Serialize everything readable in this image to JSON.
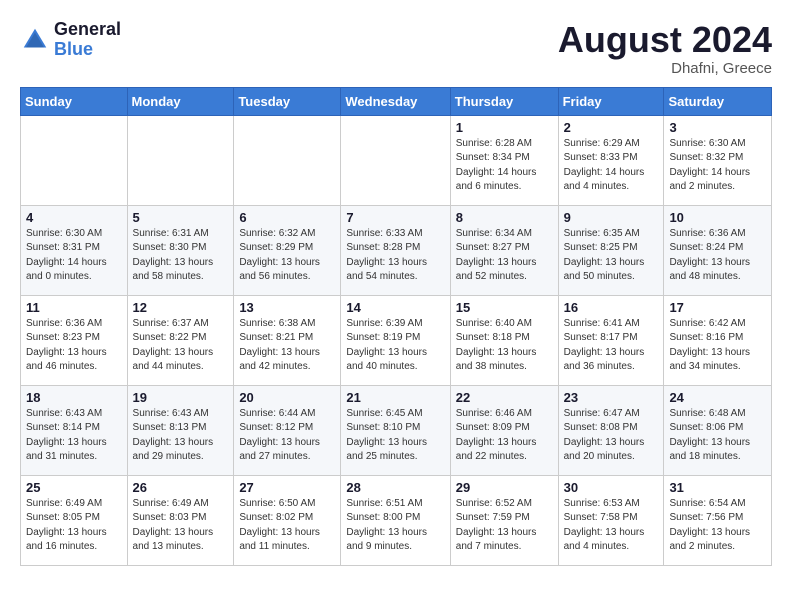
{
  "header": {
    "logo_general": "General",
    "logo_blue": "Blue",
    "month_year": "August 2024",
    "location": "Dhafni, Greece"
  },
  "weekdays": [
    "Sunday",
    "Monday",
    "Tuesday",
    "Wednesday",
    "Thursday",
    "Friday",
    "Saturday"
  ],
  "weeks": [
    [
      {
        "day": "",
        "info": ""
      },
      {
        "day": "",
        "info": ""
      },
      {
        "day": "",
        "info": ""
      },
      {
        "day": "",
        "info": ""
      },
      {
        "day": "1",
        "info": "Sunrise: 6:28 AM\nSunset: 8:34 PM\nDaylight: 14 hours\nand 6 minutes."
      },
      {
        "day": "2",
        "info": "Sunrise: 6:29 AM\nSunset: 8:33 PM\nDaylight: 14 hours\nand 4 minutes."
      },
      {
        "day": "3",
        "info": "Sunrise: 6:30 AM\nSunset: 8:32 PM\nDaylight: 14 hours\nand 2 minutes."
      }
    ],
    [
      {
        "day": "4",
        "info": "Sunrise: 6:30 AM\nSunset: 8:31 PM\nDaylight: 14 hours\nand 0 minutes."
      },
      {
        "day": "5",
        "info": "Sunrise: 6:31 AM\nSunset: 8:30 PM\nDaylight: 13 hours\nand 58 minutes."
      },
      {
        "day": "6",
        "info": "Sunrise: 6:32 AM\nSunset: 8:29 PM\nDaylight: 13 hours\nand 56 minutes."
      },
      {
        "day": "7",
        "info": "Sunrise: 6:33 AM\nSunset: 8:28 PM\nDaylight: 13 hours\nand 54 minutes."
      },
      {
        "day": "8",
        "info": "Sunrise: 6:34 AM\nSunset: 8:27 PM\nDaylight: 13 hours\nand 52 minutes."
      },
      {
        "day": "9",
        "info": "Sunrise: 6:35 AM\nSunset: 8:25 PM\nDaylight: 13 hours\nand 50 minutes."
      },
      {
        "day": "10",
        "info": "Sunrise: 6:36 AM\nSunset: 8:24 PM\nDaylight: 13 hours\nand 48 minutes."
      }
    ],
    [
      {
        "day": "11",
        "info": "Sunrise: 6:36 AM\nSunset: 8:23 PM\nDaylight: 13 hours\nand 46 minutes."
      },
      {
        "day": "12",
        "info": "Sunrise: 6:37 AM\nSunset: 8:22 PM\nDaylight: 13 hours\nand 44 minutes."
      },
      {
        "day": "13",
        "info": "Sunrise: 6:38 AM\nSunset: 8:21 PM\nDaylight: 13 hours\nand 42 minutes."
      },
      {
        "day": "14",
        "info": "Sunrise: 6:39 AM\nSunset: 8:19 PM\nDaylight: 13 hours\nand 40 minutes."
      },
      {
        "day": "15",
        "info": "Sunrise: 6:40 AM\nSunset: 8:18 PM\nDaylight: 13 hours\nand 38 minutes."
      },
      {
        "day": "16",
        "info": "Sunrise: 6:41 AM\nSunset: 8:17 PM\nDaylight: 13 hours\nand 36 minutes."
      },
      {
        "day": "17",
        "info": "Sunrise: 6:42 AM\nSunset: 8:16 PM\nDaylight: 13 hours\nand 34 minutes."
      }
    ],
    [
      {
        "day": "18",
        "info": "Sunrise: 6:43 AM\nSunset: 8:14 PM\nDaylight: 13 hours\nand 31 minutes."
      },
      {
        "day": "19",
        "info": "Sunrise: 6:43 AM\nSunset: 8:13 PM\nDaylight: 13 hours\nand 29 minutes."
      },
      {
        "day": "20",
        "info": "Sunrise: 6:44 AM\nSunset: 8:12 PM\nDaylight: 13 hours\nand 27 minutes."
      },
      {
        "day": "21",
        "info": "Sunrise: 6:45 AM\nSunset: 8:10 PM\nDaylight: 13 hours\nand 25 minutes."
      },
      {
        "day": "22",
        "info": "Sunrise: 6:46 AM\nSunset: 8:09 PM\nDaylight: 13 hours\nand 22 minutes."
      },
      {
        "day": "23",
        "info": "Sunrise: 6:47 AM\nSunset: 8:08 PM\nDaylight: 13 hours\nand 20 minutes."
      },
      {
        "day": "24",
        "info": "Sunrise: 6:48 AM\nSunset: 8:06 PM\nDaylight: 13 hours\nand 18 minutes."
      }
    ],
    [
      {
        "day": "25",
        "info": "Sunrise: 6:49 AM\nSunset: 8:05 PM\nDaylight: 13 hours\nand 16 minutes."
      },
      {
        "day": "26",
        "info": "Sunrise: 6:49 AM\nSunset: 8:03 PM\nDaylight: 13 hours\nand 13 minutes."
      },
      {
        "day": "27",
        "info": "Sunrise: 6:50 AM\nSunset: 8:02 PM\nDaylight: 13 hours\nand 11 minutes."
      },
      {
        "day": "28",
        "info": "Sunrise: 6:51 AM\nSunset: 8:00 PM\nDaylight: 13 hours\nand 9 minutes."
      },
      {
        "day": "29",
        "info": "Sunrise: 6:52 AM\nSunset: 7:59 PM\nDaylight: 13 hours\nand 7 minutes."
      },
      {
        "day": "30",
        "info": "Sunrise: 6:53 AM\nSunset: 7:58 PM\nDaylight: 13 hours\nand 4 minutes."
      },
      {
        "day": "31",
        "info": "Sunrise: 6:54 AM\nSunset: 7:56 PM\nDaylight: 13 hours\nand 2 minutes."
      }
    ]
  ]
}
